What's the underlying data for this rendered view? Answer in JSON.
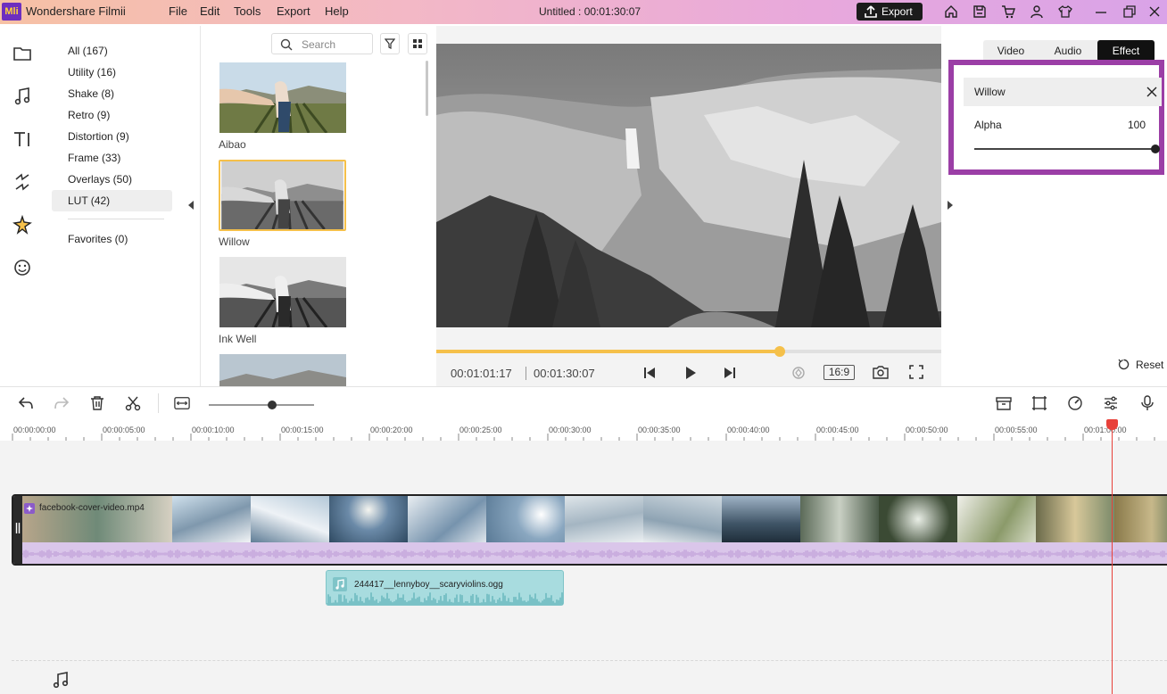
{
  "app": {
    "logo_text": "Mli",
    "name": "Wondershare Filmii",
    "menu": [
      "File",
      "Edit",
      "Tools",
      "Export",
      "Help"
    ],
    "document_title": "Untitled :  00:01:30:07",
    "export_label": "Export"
  },
  "categories": [
    {
      "label": "All (167)",
      "active": false
    },
    {
      "label": "Utility (16)",
      "active": false
    },
    {
      "label": "Shake (8)",
      "active": false
    },
    {
      "label": "Retro (9)",
      "active": false
    },
    {
      "label": "Distortion (9)",
      "active": false
    },
    {
      "label": "Frame (33)",
      "active": false
    },
    {
      "label": "Overlays (50)",
      "active": false
    },
    {
      "label": "LUT (42)",
      "active": true
    }
  ],
  "favorites_label": "Favorites (0)",
  "search": {
    "placeholder": "Search"
  },
  "effects": [
    {
      "label": "Aibao",
      "selected": false
    },
    {
      "label": "Willow",
      "selected": true
    },
    {
      "label": "Ink Well",
      "selected": false
    },
    {
      "label": "",
      "selected": false
    }
  ],
  "player": {
    "current_time": "00:01:01:17",
    "total_time": "00:01:30:07",
    "aspect_ratio": "16:9",
    "progress": 0.68
  },
  "right_panel": {
    "tabs": [
      {
        "label": "Video",
        "active": false
      },
      {
        "label": "Audio",
        "active": false
      },
      {
        "label": "Effect",
        "active": true
      }
    ],
    "effect_name": "Willow",
    "alpha_label": "Alpha",
    "alpha_value": "100",
    "reset_label": "Reset",
    "highlight_color": "#9b3ea6"
  },
  "timeline": {
    "ruler": [
      "00:00:00:00",
      "00:00:05:00",
      "00:00:10:00",
      "00:00:15:00",
      "00:00:20:00",
      "00:00:25:00",
      "00:00:30:00",
      "00:00:35:00",
      "00:00:40:00",
      "00:00:45:00",
      "00:00:50:00",
      "00:00:55:00",
      "00:01:00:00"
    ],
    "video_clip_name": "facebook-cover-video.mp4",
    "audio_clip_name": "244417__lennyboy__scaryviolins.ogg",
    "zoom_level": 0.6
  },
  "colors": {
    "accent_yellow": "#f5c04a",
    "playhead": "#e8413a",
    "audio_clip": "#a8dcdf"
  }
}
